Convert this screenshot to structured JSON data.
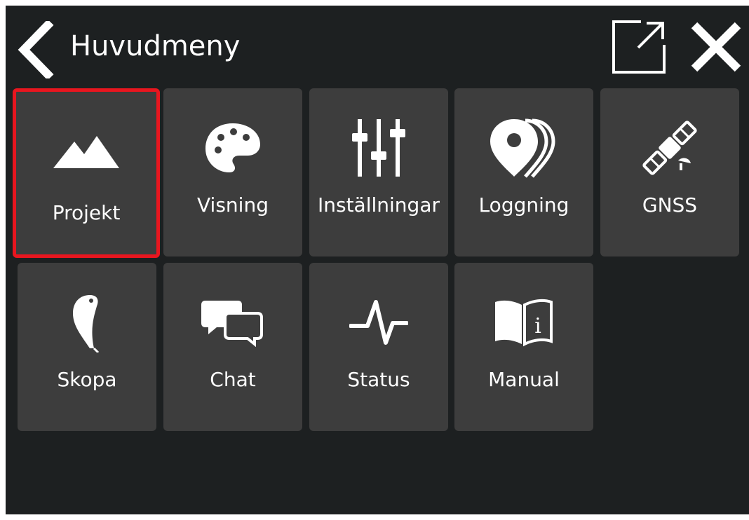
{
  "header": {
    "title": "Huvudmeny",
    "back_icon": "chevron-left-icon",
    "popout_icon": "external-window-icon",
    "close_icon": "close-icon"
  },
  "menu": {
    "items": [
      {
        "label": "Projekt",
        "icon": "mountains-icon",
        "selected": true
      },
      {
        "label": "Visning",
        "icon": "palette-icon",
        "selected": false
      },
      {
        "label": "Inställningar",
        "icon": "sliders-icon",
        "selected": false
      },
      {
        "label": "Loggning",
        "icon": "map-pins-icon",
        "selected": false
      },
      {
        "label": "GNSS",
        "icon": "satellite-icon",
        "selected": false
      },
      {
        "label": "Skopa",
        "icon": "bucket-icon",
        "selected": false
      },
      {
        "label": "Chat",
        "icon": "chat-bubbles-icon",
        "selected": false
      },
      {
        "label": "Status",
        "icon": "pulse-icon",
        "selected": false
      },
      {
        "label": "Manual",
        "icon": "info-book-icon",
        "selected": false
      }
    ]
  },
  "colors": {
    "background": "#1d2021",
    "tile": "#3d3d3d",
    "selected_border": "#e8161f",
    "foreground": "#ffffff"
  }
}
